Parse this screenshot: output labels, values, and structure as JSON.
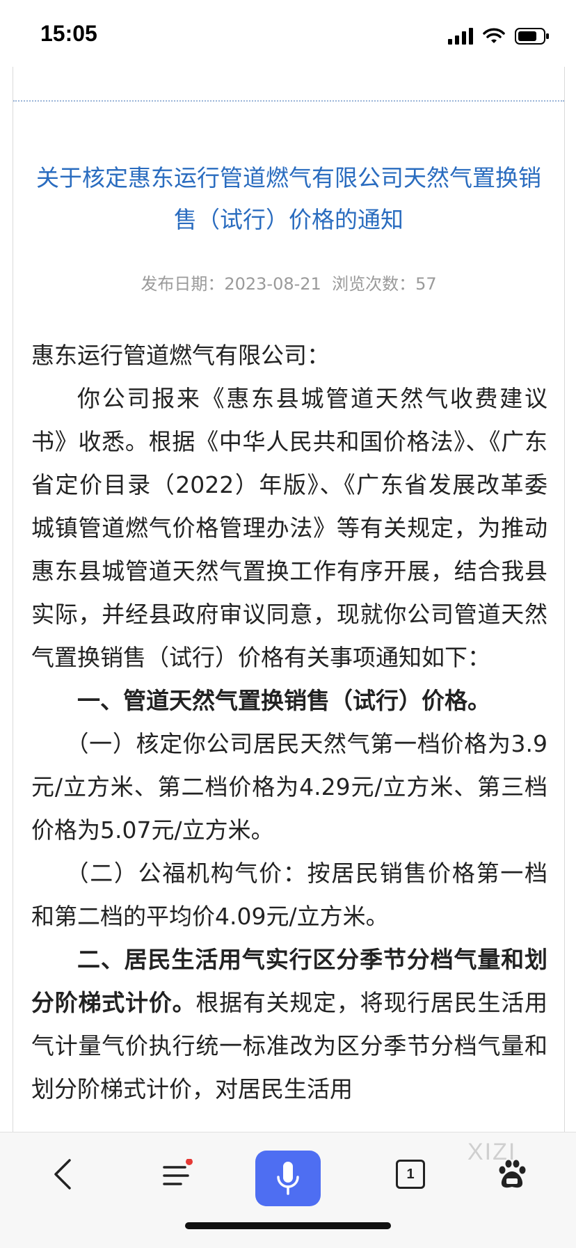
{
  "status": {
    "time": "15:05"
  },
  "article": {
    "title": "关于核定惠东运行管道燃气有限公司天然气置换销售（试行）价格的通知",
    "meta": {
      "date_label": "发布日期：",
      "date": "2023-08-21",
      "views_label": "浏览次数：",
      "views": "57"
    },
    "salutation": "惠东运行管道燃气有限公司：",
    "para1": "你公司报来《惠东县城管道天然气收费建议书》收悉。根据《中华人民共和国价格法》、《广东省定价目录（2022）年版》、《广东省发展改革委城镇管道燃气价格管理办法》等有关规定，为推动惠东县城管道天然气置换工作有序开展，结合我县实际，并经县政府审议同意，现就你公司管道天然气置换销售（试行）价格有关事项通知如下：",
    "heading1": "一、管道天然气置换销售（试行）价格。",
    "item1": "（一）核定你公司居民天然气第一档价格为3.9元/立方米、第二档价格为4.29元/立方米、第三档价格为5.07元/立方米。",
    "item2": "（二）公福机构气价：按居民销售价格第一档和第二档的平均价4.09元/立方米。",
    "heading2": "二、居民生活用气实行区分季节分档气量和划分阶梯式计价。",
    "para2": "根据有关规定，将现行居民生活用气计量气价执行统一标准改为区分季节分档气量和划分阶梯式计价，对居民生活用"
  },
  "toolbar": {
    "tab_count": "1"
  },
  "watermark": "XIZI",
  "colors": {
    "title": "#2a6cbf",
    "accent": "#4e6ef2",
    "badge": "#e53935"
  }
}
